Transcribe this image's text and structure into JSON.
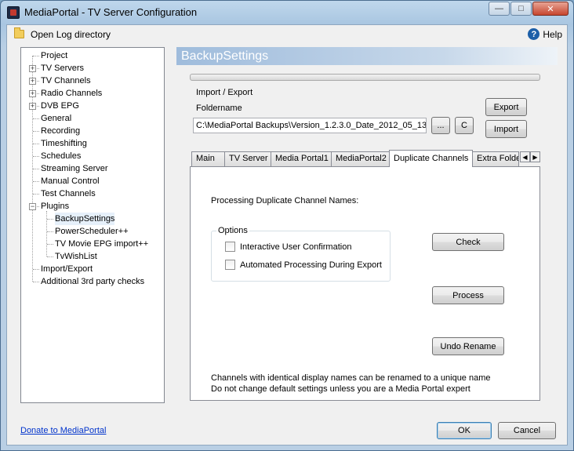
{
  "window": {
    "title": "MediaPortal - TV Server Configuration",
    "buttons": {
      "minimize": "—",
      "maximize": "□",
      "close": "✕"
    }
  },
  "toolbar": {
    "open_log": "Open Log directory",
    "help": "Help"
  },
  "tree": {
    "items": [
      {
        "label": "Project"
      },
      {
        "label": "TV Servers",
        "expander": "+"
      },
      {
        "label": "TV Channels",
        "expander": "+"
      },
      {
        "label": "Radio Channels",
        "expander": "+"
      },
      {
        "label": "DVB EPG",
        "expander": "+"
      },
      {
        "label": "General"
      },
      {
        "label": "Recording"
      },
      {
        "label": "Timeshifting"
      },
      {
        "label": "Schedules"
      },
      {
        "label": "Streaming Server"
      },
      {
        "label": "Manual Control"
      },
      {
        "label": "Test Channels"
      },
      {
        "label": "Plugins",
        "expander": "−"
      },
      {
        "label": "BackupSettings",
        "selected": true
      },
      {
        "label": "PowerScheduler++"
      },
      {
        "label": "TV Movie EPG import++"
      },
      {
        "label": "TvWishList"
      },
      {
        "label": "Import/Export"
      },
      {
        "label": "Additional 3rd party checks"
      }
    ]
  },
  "banner": {
    "title": "BackupSettings"
  },
  "import_export": {
    "group_title": "Import / Export",
    "folder_label": "Foldername",
    "folder_value": "C:\\MediaPortal Backups\\Version_1.2.3.0_Date_2012_05_13",
    "browse_label": "...",
    "c_label": "C",
    "export_label": "Export",
    "import_label": "Import"
  },
  "tabs": {
    "items": [
      "Main",
      "TV Server",
      "Media Portal1",
      "MediaPortal2",
      "Duplicate Channels",
      "Extra Folde"
    ],
    "active": "Duplicate Channels",
    "scroll_left": "◀",
    "scroll_right": "▶"
  },
  "duplicate": {
    "heading": "Processing Duplicate Channel Names:",
    "options_title": "Options",
    "option1": "Interactive User Confirmation",
    "option2": "Automated Processing During Export",
    "check_label": "Check",
    "process_label": "Process",
    "undo_label": "Undo Rename",
    "note1": "Channels with identical display names can be renamed to a unique name",
    "note2": "Do not change default settings unless you are a Media Portal expert"
  },
  "footer": {
    "donate": "Donate to MediaPortal",
    "ok": "OK",
    "cancel": "Cancel"
  },
  "colors": {
    "banner": "#9fbcdc",
    "link": "#0033cc",
    "selection": "#e6f0fa"
  }
}
